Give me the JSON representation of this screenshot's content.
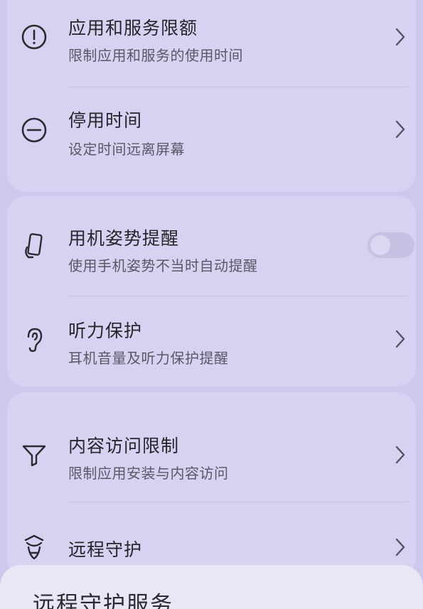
{
  "settings": {
    "app_limits": {
      "title": "应用和服务限额",
      "subtitle": "限制应用和服务的使用时间",
      "icon": "alert-circle-icon"
    },
    "downtime": {
      "title": "停用时间",
      "subtitle": "设定时间远离屏幕",
      "icon": "minus-circle-icon"
    },
    "posture_reminder": {
      "title": "用机姿势提醒",
      "subtitle": "使用手机姿势不当时自动提醒",
      "icon": "phone-hand-icon",
      "enabled": false
    },
    "hearing_protection": {
      "title": "听力保护",
      "subtitle": "耳机音量及听力保护提醒",
      "icon": "ear-icon"
    },
    "content_restrictions": {
      "title": "内容访问限制",
      "subtitle": "限制应用安装与内容访问",
      "icon": "filter-icon"
    },
    "remote_guard": {
      "title": "远程守护",
      "icon": "shield-guard-icon"
    }
  },
  "bottom_sheet": {
    "title": "远程守护服务"
  }
}
